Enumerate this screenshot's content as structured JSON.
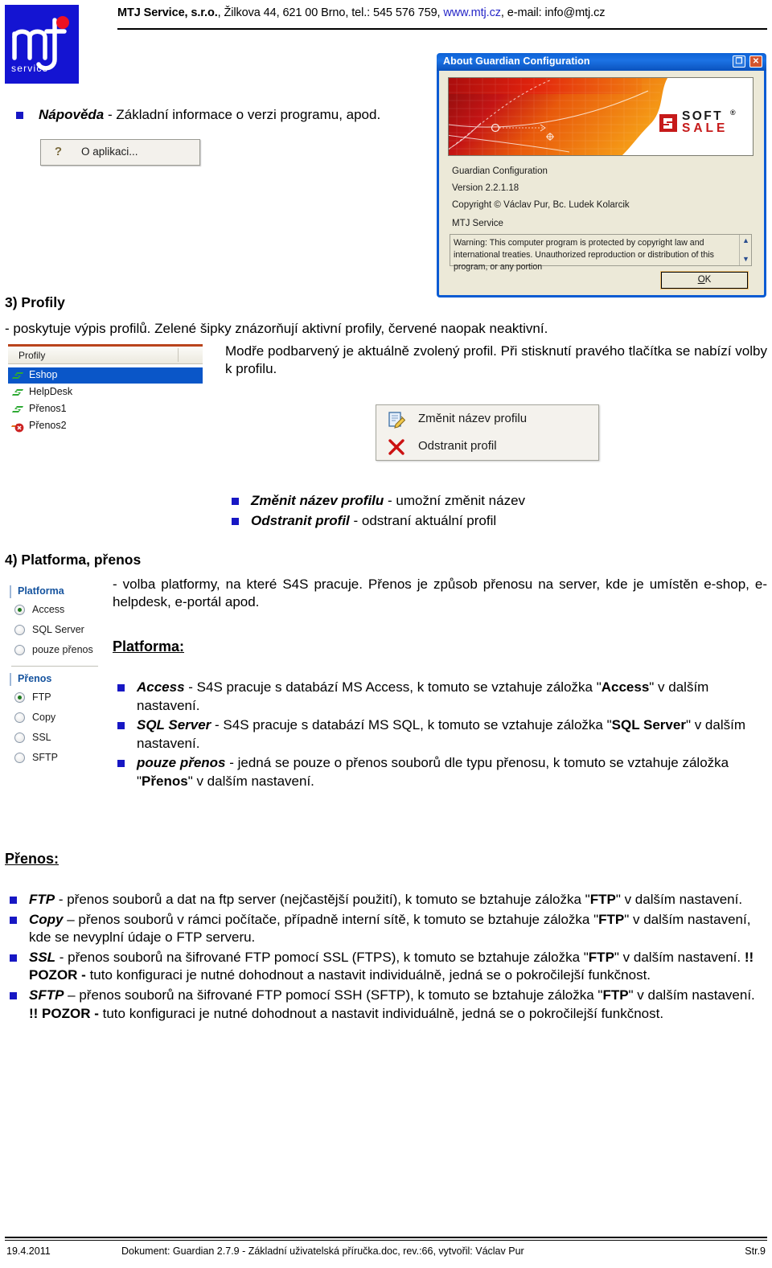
{
  "header": {
    "company": "MTJ Service, s.r.o.",
    "address": ", Žilkova 44, 621 00 Brno, tel.: 545 576 759, ",
    "link": "www.mtj.cz",
    "email": ", e-mail: info@mtj.cz",
    "logo_main": "mtj",
    "logo_sub": "service"
  },
  "napoveda": {
    "bullet_bold": "Nápověda",
    "bullet_rest": " - Základní informace o verzi programu, apod.",
    "menu_item": "O aplikaci...",
    "menu_icon": "question-mark-icon"
  },
  "about_dialog": {
    "title": "About Guardian Configuration",
    "restore_glyph": "❐",
    "close_glyph": "✕",
    "banner_logo_top": "SOFT",
    "banner_logo_reg": "®",
    "banner_logo_bottom": "SALE",
    "app_name": "Guardian Configuration",
    "version": "Version 2.2.1.18",
    "copyright": "Copyright © Václav Pur, Bc. Ludek Kolarcik",
    "vendor": "MTJ Service",
    "warning": "Warning: This computer program is protected by copyright law and international treaties. Unauthorized reproduction or distribution of this program, or any portion",
    "scroll_up": "▲",
    "scroll_down": "▼",
    "ok_button_prefix": "",
    "ok_button_accel": "O",
    "ok_button_suffix": "K"
  },
  "section3": {
    "heading": "3) Profily",
    "intro": "- poskytuje výpis profilů. Zelené šipky znázorňují aktivní profily, červené naopak neaktivní.",
    "para": "Modře podbarvený je aktuálně zvolený profil. Při stisknutí pravého tlačítka se nabízí volby k profilu.",
    "list_header": "Profily",
    "profiles": [
      {
        "label": "Eshop",
        "state": "active",
        "selected": true
      },
      {
        "label": "HelpDesk",
        "state": "active",
        "selected": false
      },
      {
        "label": "Přenos1",
        "state": "active",
        "selected": false
      },
      {
        "label": "Přenos2",
        "state": "inactive",
        "selected": false
      }
    ],
    "context_menu": [
      {
        "label": "Změnit název profilu",
        "icon": "edit-document-icon"
      },
      {
        "label": "Odstranit profil",
        "icon": "red-x-delete-icon"
      }
    ],
    "bullets": [
      {
        "bold": "Změnit název profilu",
        "rest": " - umožní změnit název"
      },
      {
        "bold": "Odstranit profil",
        "rest": " - odstraní aktuální profil"
      }
    ]
  },
  "section4": {
    "heading": "4) Platforma, přenos",
    "intro": "- volba platformy, na které S4S pracuje. Přenos je způsob přenosu na server, kde je umístěn e-shop, e-helpdesk, e-portál apod.",
    "platform_heading": "Platforma:",
    "transfer_heading": "Přenos:",
    "radio_groups": [
      {
        "title": "Platforma",
        "options": [
          {
            "label": "Access",
            "selected": true
          },
          {
            "label": "SQL Server",
            "selected": false
          },
          {
            "label": "pouze přenos",
            "selected": false
          }
        ]
      },
      {
        "title": "Přenos",
        "options": [
          {
            "label": "FTP",
            "selected": true
          },
          {
            "label": "Copy",
            "selected": false
          },
          {
            "label": "SSL",
            "selected": false
          },
          {
            "label": "SFTP",
            "selected": false
          }
        ]
      }
    ],
    "platform_bullets": [
      {
        "bold": "Access",
        "parts": [
          {
            "t": " - S4S pracuje s databází MS Access, k tomuto se vztahuje záložka \"",
            "b": false
          },
          {
            "t": "Access",
            "b": true
          },
          {
            "t": "\" v dalším nastavení.",
            "b": false
          }
        ]
      },
      {
        "bold": "SQL Server",
        "parts": [
          {
            "t": " - S4S pracuje s databází MS SQL, k tomuto se vztahuje záložka \"",
            "b": false
          },
          {
            "t": "SQL Server",
            "b": true
          },
          {
            "t": "\" v dalším nastavení.",
            "b": false
          }
        ]
      },
      {
        "bold": "pouze přenos",
        "parts": [
          {
            "t": " - jedná se pouze o přenos souborů dle typu přenosu, k tomuto se vztahuje záložka \"",
            "b": false
          },
          {
            "t": "Přenos",
            "b": true
          },
          {
            "t": "\" v dalším nastavení.",
            "b": false
          }
        ]
      }
    ],
    "transfer_bullets": [
      {
        "bold": "FTP",
        "parts": [
          {
            "t": " - přenos souborů a dat na ftp server (nejčastější použití), k tomuto se bztahuje záložka \"",
            "b": false
          },
          {
            "t": "FTP",
            "b": true
          },
          {
            "t": "\" v dalším nastavení.",
            "b": false
          }
        ]
      },
      {
        "bold": "Copy",
        "parts": [
          {
            "t": " – přenos souborů v rámci počítače, případně interní sítě, k tomuto se bztahuje záložka \"",
            "b": false
          },
          {
            "t": "FTP",
            "b": true
          },
          {
            "t": "\" v dalším nastavení, kde se nevyplní údaje o FTP serveru.",
            "b": false
          }
        ]
      },
      {
        "bold": "SSL",
        "parts": [
          {
            "t": " - přenos souborů na šifrované FTP pomocí SSL (FTPS), k tomuto se bztahuje záložka \"",
            "b": false
          },
          {
            "t": "FTP",
            "b": true
          },
          {
            "t": "\" v dalším nastavení. ",
            "b": false
          },
          {
            "t": "!! POZOR -",
            "b": true
          },
          {
            "t": " tuto konfiguraci je nutné dohodnout a nastavit individuálně, jedná se o pokročilejší funkčnost.",
            "b": false
          }
        ]
      },
      {
        "bold": "SFTP",
        "parts": [
          {
            "t": " – přenos souborů na šifrované FTP pomocí SSH (SFTP), k tomuto se bztahuje záložka \"",
            "b": false
          },
          {
            "t": "FTP",
            "b": true
          },
          {
            "t": "\" v dalším nastavení. ",
            "b": false
          },
          {
            "t": "!! POZOR -",
            "b": true
          },
          {
            "t": " tuto konfiguraci je nutné dohodnout a nastavit individuálně, jedná se o pokročilejší funkčnost.",
            "b": false
          }
        ]
      }
    ]
  },
  "footer": {
    "date": "19.4.2011",
    "document": "Dokument: Guardian 2.7.9 - Základní uživatelská příručka.doc, rev.:66, vytvořil: Václav Pur",
    "page": "Str.9"
  },
  "colors": {
    "bullet_square": "#1717c4",
    "link": "#2727c8",
    "logo_bg": "#1414d2",
    "selection": "#0a56c8",
    "group_title": "#15539e",
    "active_profile": "#2eaa34",
    "inactive_profile": "#cc2222"
  }
}
